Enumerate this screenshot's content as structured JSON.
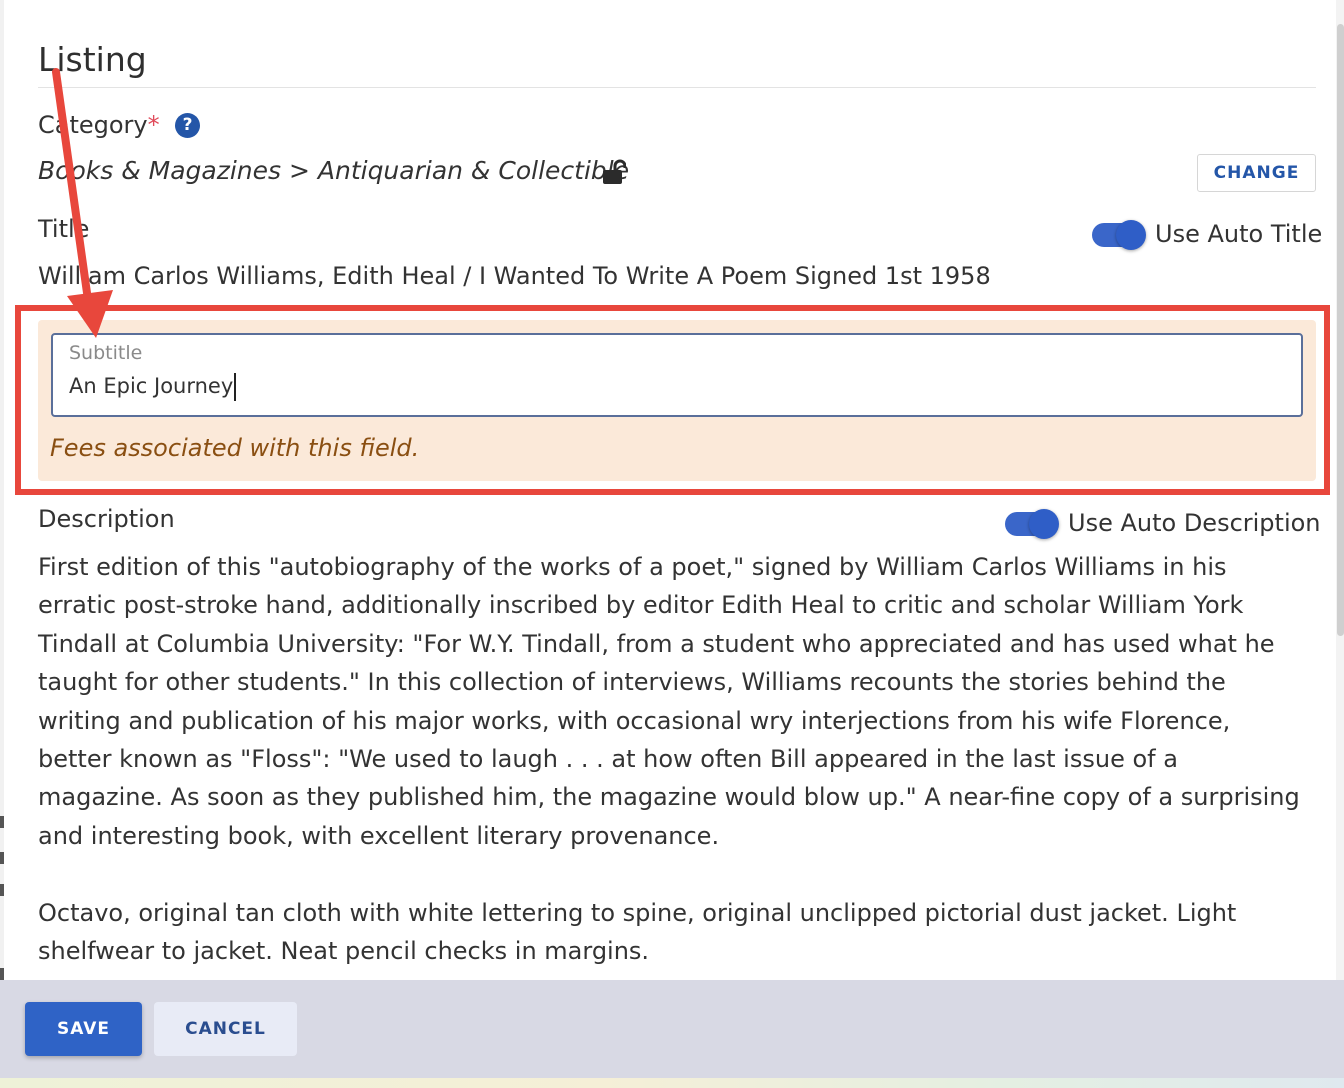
{
  "section": {
    "heading": "Listing"
  },
  "category": {
    "label": "Category",
    "required_mark": "*",
    "help_glyph": "?",
    "path": "Books & Magazines > Antiquarian & Collectible",
    "change_label": "CHANGE"
  },
  "title": {
    "label": "Title",
    "auto_toggle_label": "Use Auto Title",
    "auto_enabled": true,
    "value": "William Carlos Williams, Edith Heal / I Wanted To Write A Poem Signed 1st 1958"
  },
  "subtitle": {
    "label": "Subtitle",
    "value": "An Epic Journey",
    "fee_note": "Fees associated with this field."
  },
  "description": {
    "label": "Description",
    "auto_toggle_label": "Use Auto Description",
    "auto_enabled": true,
    "paragraph1": "First edition of this \"autobiography of the works of a poet,\" signed by William Carlos Williams in his erratic post-stroke hand, additionally inscribed by editor Edith Heal to critic and scholar William York Tindall at Columbia University: \"For W.Y. Tindall, from a student who appreciated and has used what he taught for other students.\" In this collection of interviews, Williams recounts the stories behind the writing and publication of his major works, with occasional wry interjections from his wife Florence, better known as \"Floss\": \"We used to laugh . . . at how often Bill appeared in the last issue of a magazine. As soon as they published him, the magazine would blow up.\" A near-fine copy of a surprising and interesting book, with excellent literary provenance.",
    "paragraph2": "Octavo, original tan cloth with white lettering to spine, original unclipped pictorial dust jacket. Light shelfwear to jacket. Neat pencil checks in margins."
  },
  "footer": {
    "save_label": "SAVE",
    "cancel_label": "CANCEL"
  },
  "colors": {
    "accent": "#2f63c6",
    "annotation_red": "#e8473c",
    "fee_background": "#fbe9d9",
    "fee_text": "#8a4f12",
    "required": "#e04a5a"
  },
  "icons": {
    "help": "question-circle-icon",
    "lock": "unlock-icon"
  }
}
